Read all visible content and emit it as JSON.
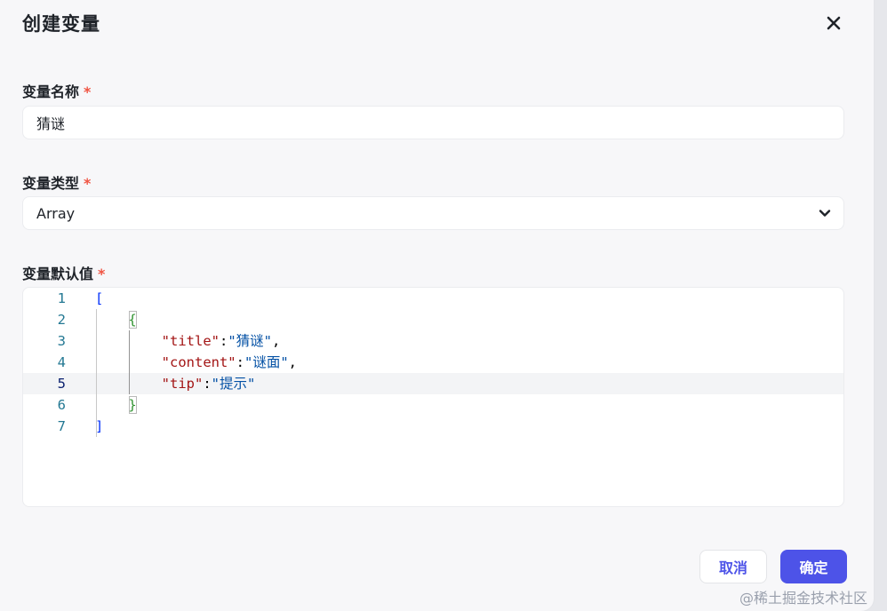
{
  "dialog": {
    "title": "创建变量",
    "close_icon": "close-icon"
  },
  "form": {
    "name_label": "变量名称",
    "name_value": "猜谜",
    "type_label": "变量类型",
    "type_value": "Array",
    "default_label": "变量默认值",
    "required_mark": "*"
  },
  "editor": {
    "line_numbers": [
      "1",
      "2",
      "3",
      "4",
      "5",
      "6",
      "7"
    ],
    "active_line": "5",
    "lines": [
      [
        {
          "t": "[",
          "c": "br-blue"
        }
      ],
      [
        {
          "t": "    "
        },
        {
          "t": "{",
          "c": "br-green"
        }
      ],
      [
        {
          "t": "        "
        },
        {
          "t": "\"title\"",
          "c": "key"
        },
        {
          "t": ":",
          "c": "punc"
        },
        {
          "t": "\"猜谜\"",
          "c": "str"
        },
        {
          "t": ",",
          "c": "punc"
        }
      ],
      [
        {
          "t": "        "
        },
        {
          "t": "\"content\"",
          "c": "key"
        },
        {
          "t": ":",
          "c": "punc"
        },
        {
          "t": "\"谜面\"",
          "c": "str"
        },
        {
          "t": ",",
          "c": "punc"
        }
      ],
      [
        {
          "t": "        "
        },
        {
          "t": "\"tip\"",
          "c": "key"
        },
        {
          "t": ":",
          "c": "punc"
        },
        {
          "t": "\"提示\"",
          "c": "str"
        }
      ],
      [
        {
          "t": "    "
        },
        {
          "t": "}",
          "c": "br-green"
        }
      ],
      [
        {
          "t": "]",
          "c": "br-blue"
        }
      ]
    ]
  },
  "footer": {
    "cancel_label": "取消",
    "ok_label": "确定"
  },
  "watermark": "@稀土掘金技术社区",
  "colors": {
    "accent": "#4d53e8",
    "required": "#f05442"
  }
}
